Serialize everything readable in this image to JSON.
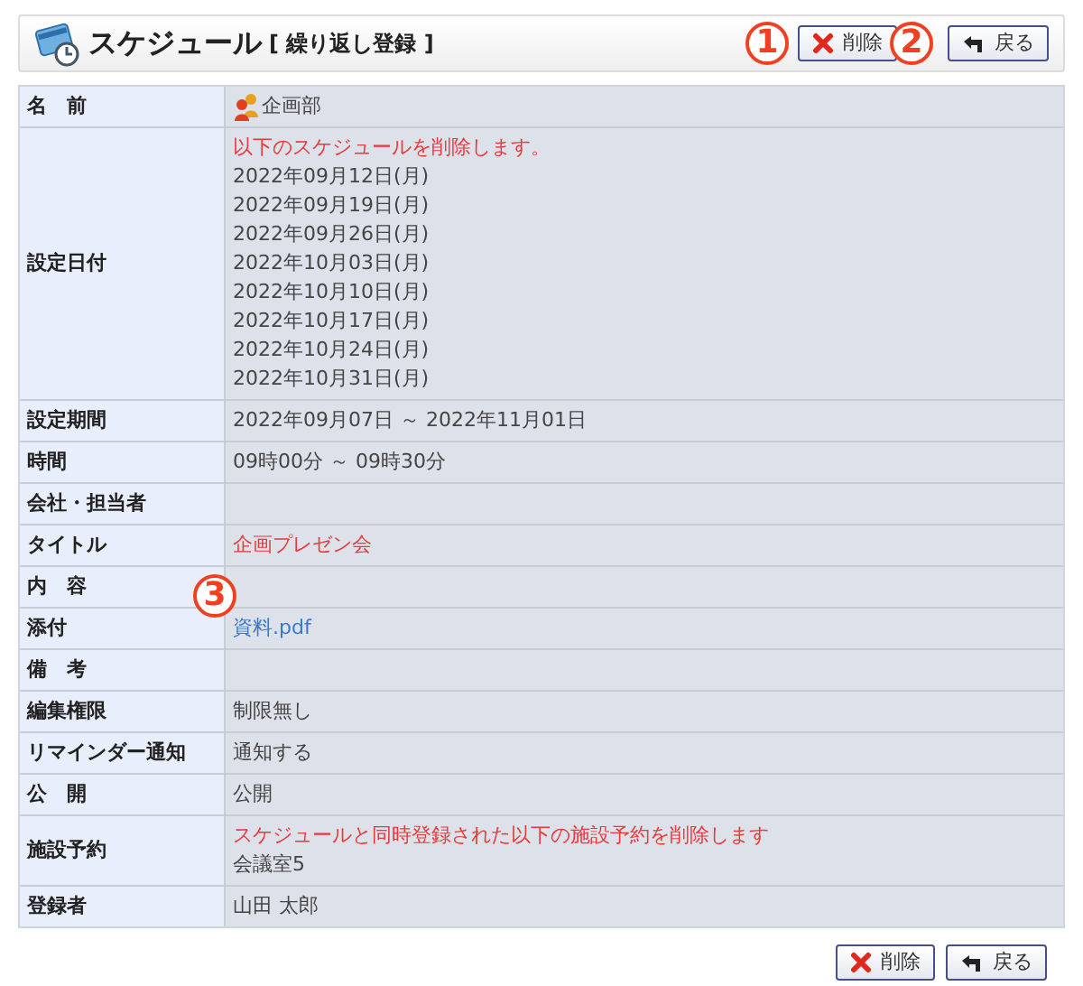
{
  "header": {
    "title": "スケジュール",
    "subtitle": "[ 繰り返し登録 ]",
    "buttons": [
      {
        "kind": "delete",
        "label": "削除"
      },
      {
        "kind": "back",
        "label": "戻る"
      }
    ]
  },
  "rows": [
    {
      "label": "名　前",
      "lines": [
        {
          "kind": "group",
          "text": "企画部"
        }
      ]
    },
    {
      "label": "設定日付",
      "lines": [
        {
          "kind": "warning",
          "text": "以下のスケジュールを削除します。"
        },
        {
          "kind": "text",
          "text": "2022年09月12日(月)"
        },
        {
          "kind": "text",
          "text": "2022年09月19日(月)"
        },
        {
          "kind": "text",
          "text": "2022年09月26日(月)"
        },
        {
          "kind": "text",
          "text": "2022年10月03日(月)"
        },
        {
          "kind": "text",
          "text": "2022年10月10日(月)"
        },
        {
          "kind": "text",
          "text": "2022年10月17日(月)"
        },
        {
          "kind": "text",
          "text": "2022年10月24日(月)"
        },
        {
          "kind": "text",
          "text": "2022年10月31日(月)"
        }
      ]
    },
    {
      "label": "設定期間",
      "lines": [
        {
          "kind": "text",
          "text": "2022年09月07日 ～ 2022年11月01日"
        }
      ]
    },
    {
      "label": "時間",
      "lines": [
        {
          "kind": "text",
          "text": "09時00分 ～ 09時30分"
        }
      ]
    },
    {
      "label": "会社・担当者",
      "lines": []
    },
    {
      "label": "タイトル",
      "lines": [
        {
          "kind": "warning",
          "text": "企画プレゼン会"
        }
      ]
    },
    {
      "label": "内　容",
      "lines": []
    },
    {
      "label": "添付",
      "lines": [
        {
          "kind": "link",
          "text": "資料.pdf"
        }
      ]
    },
    {
      "label": "備　考",
      "lines": []
    },
    {
      "label": "編集権限",
      "lines": [
        {
          "kind": "text",
          "text": "制限無し"
        }
      ]
    },
    {
      "label": "リマインダー通知",
      "lines": [
        {
          "kind": "text",
          "text": "通知する"
        }
      ]
    },
    {
      "label": "公　開",
      "lines": [
        {
          "kind": "text",
          "text": "公開"
        }
      ]
    },
    {
      "label": "施設予約",
      "lines": [
        {
          "kind": "warning",
          "text": "スケジュールと同時登録された以下の施設予約を削除します"
        },
        {
          "kind": "text",
          "text": "会議室5"
        }
      ]
    },
    {
      "label": "登録者",
      "lines": [
        {
          "kind": "text",
          "text": "山田 太郎"
        }
      ]
    }
  ],
  "footer_buttons": [
    {
      "kind": "delete",
      "label": "削除"
    },
    {
      "kind": "back",
      "label": "戻る"
    }
  ],
  "callouts": [
    "1",
    "2",
    "3"
  ]
}
